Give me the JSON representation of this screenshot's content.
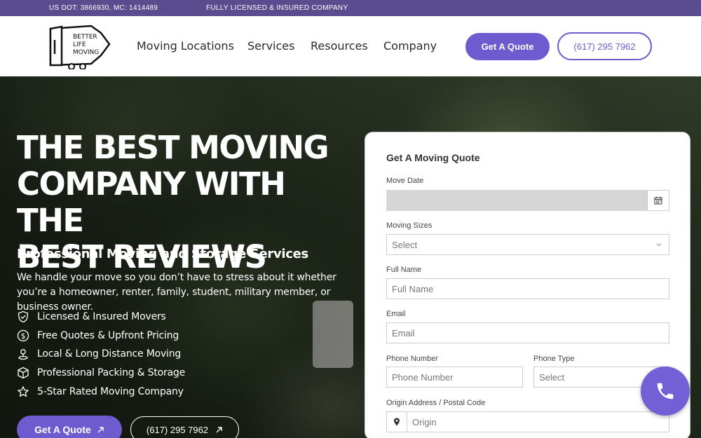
{
  "topbar": {
    "dot_text": "US DOT: 3866930, MC: 1414489",
    "license_text": "FULLY LICENSED & INSURED COMPANY"
  },
  "header": {
    "logo_text": [
      "BETTER",
      "LIFE",
      "MOVING"
    ],
    "nav": [
      {
        "label": "Moving Locations"
      },
      {
        "label": "Services"
      },
      {
        "label": "Resources"
      },
      {
        "label": "Company"
      }
    ],
    "quote_label": "Get A Quote",
    "phone_label": "(617) 295 7962"
  },
  "hero": {
    "title_lines": [
      "THE BEST MOVING",
      "COMPANY WITH THE",
      "BEST REVIEWS"
    ],
    "subtitle": "Professional Moving and Storage Services",
    "description": "We handle your move so you don’t have to stress about it whether you’re a homeowner, renter, family, student, military member, or business owner.",
    "features": [
      {
        "label": "Licensed & Insured Movers",
        "icon": "shield-check-icon"
      },
      {
        "label": "Free Quotes & Upfront Pricing",
        "icon": "dollar-icon"
      },
      {
        "label": "Local & Long Distance Moving",
        "icon": "location-pin-icon"
      },
      {
        "label": "Professional Packing & Storage",
        "icon": "box-icon"
      },
      {
        "label": "5-Star Rated Moving Company",
        "icon": "star-icon"
      }
    ],
    "quote_label": "Get A Quote",
    "phone_label": "(617) 295 7962"
  },
  "form": {
    "title": "Get A Moving Quote",
    "move_date": {
      "label": "Move Date",
      "value": ""
    },
    "moving_sizes": {
      "label": "Moving Sizes",
      "value": "Select"
    },
    "full_name": {
      "label": "Full Name",
      "placeholder": "Full Name"
    },
    "email": {
      "label": "Email",
      "placeholder": "Email"
    },
    "phone_number": {
      "label": "Phone Number",
      "placeholder": "Phone Number"
    },
    "phone_type": {
      "label": "Phone Type",
      "value": "Select"
    },
    "origin": {
      "label": "Origin Address / Postal Code",
      "placeholder": "Origin"
    }
  },
  "colors": {
    "accent": "#6e5bd0",
    "topbar": "#5a4c8f"
  }
}
